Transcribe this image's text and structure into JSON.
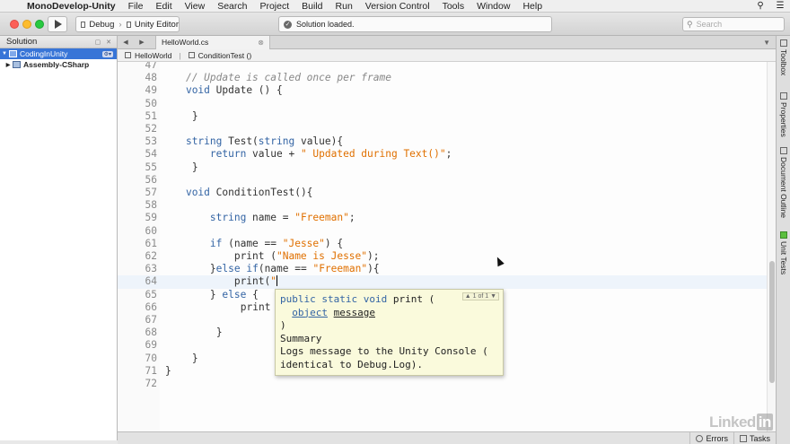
{
  "menubar": {
    "app_name": "MonoDevelop-Unity",
    "items": [
      "File",
      "Edit",
      "View",
      "Search",
      "Project",
      "Build",
      "Run",
      "Version Control",
      "Tools",
      "Window",
      "Help"
    ]
  },
  "toolbar": {
    "config": "Debug",
    "target": "Unity Editor",
    "status": "Solution loaded.",
    "search_placeholder": "Search"
  },
  "solution": {
    "title": "Solution",
    "items": [
      {
        "label": "CodingInUnity",
        "selected": true
      },
      {
        "label": "Assembly-CSharp",
        "selected": false
      }
    ]
  },
  "editor": {
    "tab": "HelloWorld.cs",
    "path": [
      "HelloWorld",
      "ConditionTest ()"
    ]
  },
  "code_lines": [
    {
      "n": "47",
      "t": ""
    },
    {
      "n": "48",
      "t": ""
    },
    {
      "n": "49",
      "t": ""
    },
    {
      "n": "50",
      "t": ""
    },
    {
      "n": "51",
      "t": "        }"
    },
    {
      "n": "52",
      "t": ""
    },
    {
      "n": "53",
      "t": ""
    },
    {
      "n": "54",
      "t": ""
    },
    {
      "n": "55",
      "t": "        }"
    },
    {
      "n": "56",
      "t": ""
    },
    {
      "n": "57",
      "t": ""
    },
    {
      "n": "58",
      "t": ""
    },
    {
      "n": "59",
      "t": ""
    },
    {
      "n": "60",
      "t": ""
    },
    {
      "n": "61",
      "t": ""
    },
    {
      "n": "62",
      "t": ""
    },
    {
      "n": "63",
      "t": ""
    },
    {
      "n": "64",
      "t": ""
    },
    {
      "n": "65",
      "t": ""
    },
    {
      "n": "66",
      "t": "                print"
    },
    {
      "n": "67",
      "t": ""
    },
    {
      "n": "68",
      "t": "            }"
    },
    {
      "n": "69",
      "t": ""
    },
    {
      "n": "70",
      "t": "        }"
    },
    {
      "n": "71",
      "t": "    }"
    },
    {
      "n": "72",
      "t": ""
    }
  ],
  "code": {
    "l48_comment": "// Update is called once per frame",
    "l49_void": "void",
    "l49_rest": " Update () {",
    "l53_string": "string",
    "l53_mid": " Test(",
    "l53_string2": "string",
    "l53_end": " value){",
    "l54_return": "return",
    "l54_mid": " value + ",
    "l54_str": "\" Updated during Text()\"",
    "l54_end": ";",
    "l57_void": "void",
    "l57_rest": " ConditionTest(){",
    "l59_string": "string",
    "l59_mid": " name = ",
    "l59_str": "\"Freeman\"",
    "l59_end": ";",
    "l61_if": "if",
    "l61_mid": " (name == ",
    "l61_str": "\"Jesse\"",
    "l61_end": ") {",
    "l62_pre": "print (",
    "l62_str": "\"Name is Jesse\"",
    "l62_end": ");",
    "l63_pre": "}",
    "l63_else": "else",
    "l63_if": "if",
    "l63_mid": "(name == ",
    "l63_str": "\"Freeman\"",
    "l63_end": "){",
    "l64_pre": "print(",
    "l64_str": "\"",
    "l65_pre": "} ",
    "l65_else": "else",
    "l65_end": " {"
  },
  "tooltip": {
    "counter": "▲ 1 of 1 ▼",
    "sig_kw": "public static void",
    "sig_name": " print (",
    "param_type": "object",
    "param_name": "message",
    "close": ")",
    "summary_title": "Summary",
    "summary_1": "Logs message to the Unity Console (",
    "summary_2": "identical to Debug.Log)."
  },
  "dock": [
    "Toolbox",
    "Properties",
    "Document Outline",
    "Unit Tests"
  ],
  "statusbar": {
    "errors": "Errors",
    "tasks": "Tasks"
  },
  "watermark": {
    "brand": "Linked",
    "in": "in"
  },
  "colors": {
    "keyword": "#3364a4",
    "string": "#e07000",
    "comment": "#888888",
    "selection": "#3875d7"
  }
}
